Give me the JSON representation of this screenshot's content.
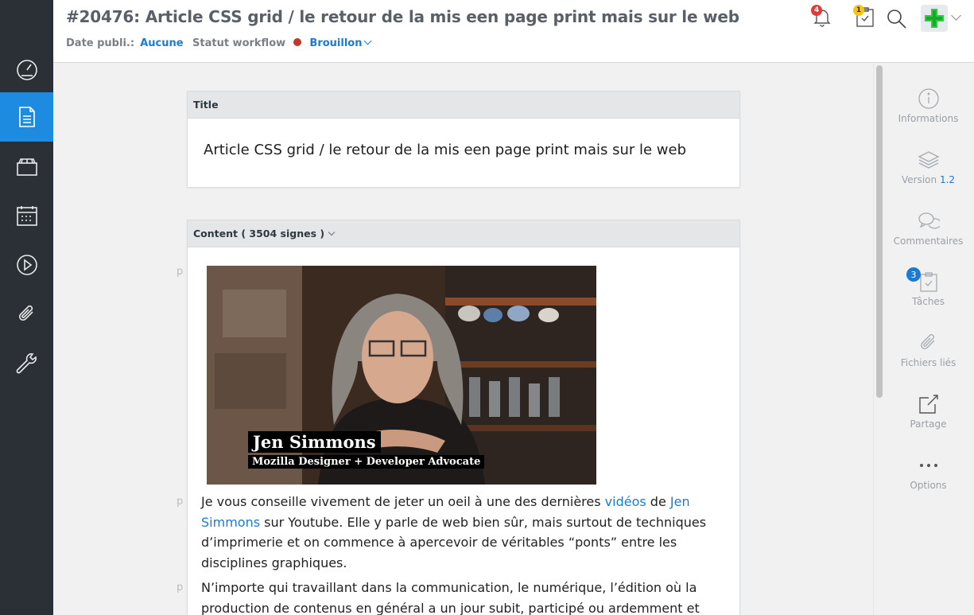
{
  "header": {
    "title": "#20476: Article CSS grid / le retour de la mis een page print mais sur le web",
    "date_label": "Date publi.:",
    "date_value": "Aucune",
    "workflow_label": "Statut workflow",
    "workflow_value": "Brouillon",
    "workflow_color": "#c0392b",
    "notifications_count": "4",
    "tasks_count": "1"
  },
  "leftnav": {
    "items": [
      {
        "icon": "dashboard-icon"
      },
      {
        "icon": "article-icon",
        "active": true
      },
      {
        "icon": "media-icon"
      },
      {
        "icon": "calendar-icon"
      },
      {
        "icon": "video-icon"
      },
      {
        "icon": "attachment-icon"
      },
      {
        "icon": "settings-icon"
      }
    ]
  },
  "title_card": {
    "label": "Title",
    "value": "Article CSS grid / le retour de la mis een page print mais sur le web"
  },
  "content_card": {
    "label": "Content ( 3504 signes )",
    "p_marker": "p",
    "video": {
      "caption_name": "Jen Simmons",
      "caption_role": "Mozilla Designer + Developer Advocate"
    },
    "para1": {
      "t1": "Je vous conseille vivement de jeter un oeil à une des dernières ",
      "link1": "vidéos",
      "t2": " de ",
      "link2": "Jen Simmons",
      "t3": " sur Youtube. Elle y parle de web bien sûr, mais surtout de techniques d’imprimerie et on commence à apercevoir de véritables “ponts” entre les disciplines graphiques."
    },
    "para2": "N’importe qui travaillant dans la communication, le numérique, l’édition où la production de contenus en général a un jour subit, participé ou ardemment et"
  },
  "right_panel": {
    "informations": "Informations",
    "version_label": "Version",
    "version_value": "1.2",
    "commentaires": "Commentaires",
    "taches": "Tâches",
    "taches_count": "3",
    "fichiers": "Fichiers liés",
    "partage": "Partage",
    "options": "Options"
  },
  "colors": {
    "accent": "#1c7bd0",
    "nav_bg": "#2a3035",
    "nav_active": "#1c8be0"
  }
}
